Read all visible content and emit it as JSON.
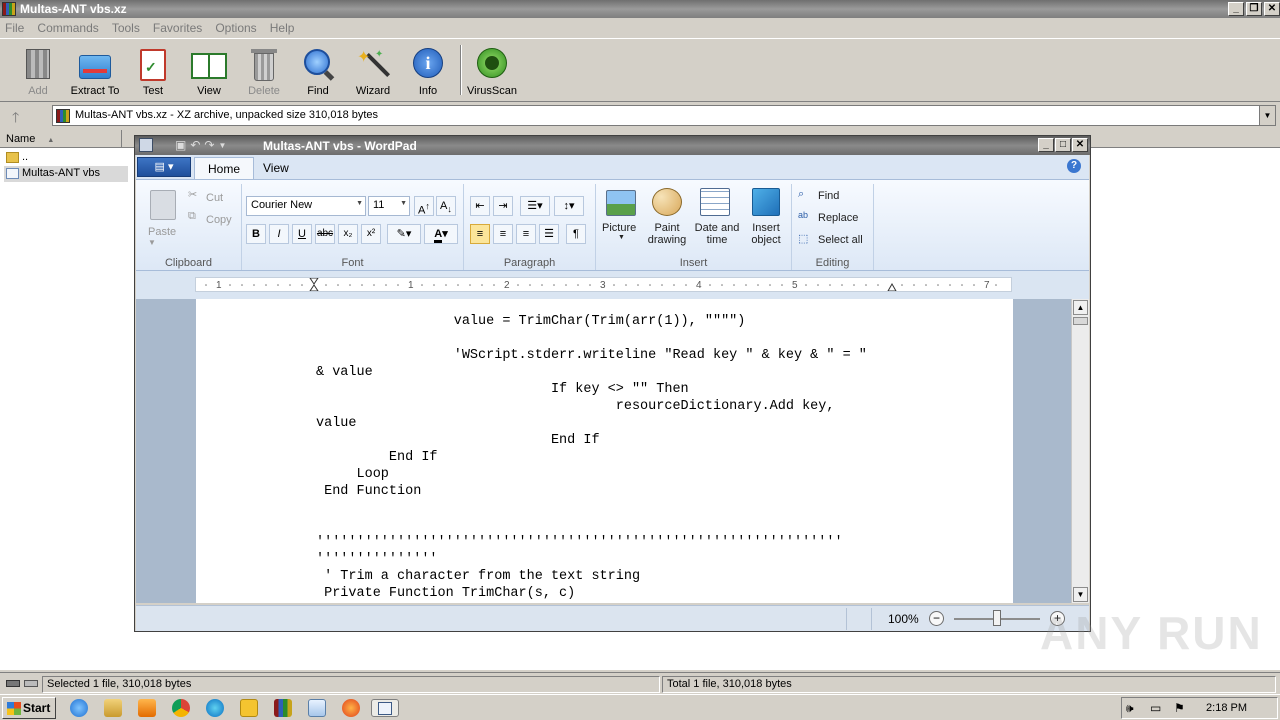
{
  "rar": {
    "title": "Multas-ANT vbs.xz",
    "menu": [
      "File",
      "Commands",
      "Tools",
      "Favorites",
      "Options",
      "Help"
    ],
    "toolbar": [
      {
        "label": "Add",
        "icon": "add-archive-icon",
        "enabled": false
      },
      {
        "label": "Extract To",
        "icon": "extract-folder-icon",
        "enabled": true
      },
      {
        "label": "Test",
        "icon": "test-checklist-icon",
        "enabled": true
      },
      {
        "label": "View",
        "icon": "view-book-icon",
        "enabled": true
      },
      {
        "label": "Delete",
        "icon": "trash-icon",
        "enabled": false
      },
      {
        "label": "Find",
        "icon": "magnifier-icon",
        "enabled": true
      },
      {
        "label": "Wizard",
        "icon": "wizard-wand-icon",
        "enabled": true
      },
      {
        "label": "Info",
        "icon": "info-icon",
        "enabled": true
      },
      {
        "label": "VirusScan",
        "icon": "virus-scan-icon",
        "enabled": true
      }
    ],
    "address": "Multas-ANT vbs.xz - XZ archive, unpacked size 310,018 bytes",
    "column_name": "Name",
    "files": [
      {
        "name": "..",
        "type": "folder"
      },
      {
        "name": "Multas-ANT vbs",
        "type": "file"
      }
    ],
    "status_left": "Selected 1 file, 310,018 bytes",
    "status_right": "Total 1 file, 310,018 bytes"
  },
  "wordpad": {
    "title": "Multas-ANT vbs - WordPad",
    "tabs": [
      "Home",
      "View"
    ],
    "clipboard": {
      "paste": "Paste",
      "cut": "Cut",
      "copy": "Copy",
      "group": "Clipboard"
    },
    "font": {
      "family": "Courier New",
      "size": "11",
      "group": "Font"
    },
    "paragraph_group": "Paragraph",
    "insert": {
      "picture": "Picture",
      "paint_line1": "Paint",
      "paint_line2": "drawing",
      "datetime_line1": "Date and",
      "datetime_line2": "time",
      "object_line1": "Insert",
      "object_line2": "object",
      "group": "Insert"
    },
    "editing": {
      "find": "Find",
      "replace": "Replace",
      "select_all": "Select all",
      "group": "Editing"
    },
    "ruler_marks": [
      "1",
      "1",
      "2",
      "3",
      "4",
      "5",
      "7"
    ],
    "code_lines": [
      "                 value = TrimChar(Trim(arr(1)), \"\"\"\")",
      "",
      "                 'WScript.stderr.writeline \"Read key \" & key & \" = \"",
      "& value",
      "                             If key <> \"\" Then",
      "                                     resourceDictionary.Add key,",
      "value",
      "                             End If",
      "         End If",
      "     Loop",
      " End Function",
      "",
      "",
      "'''''''''''''''''''''''''''''''''''''''''''''''''''''''''''''''''",
      "'''''''''''''''",
      " ' Trim a character from the text string",
      " Private Function TrimChar(s, c)"
    ],
    "zoom": "100%",
    "zoom_level_fraction": 0.5
  },
  "taskbar": {
    "start": "Start",
    "clock": "2:18 PM",
    "apps": [
      "ie-icon",
      "explorer-icon",
      "media-player-icon",
      "chrome-icon",
      "edge-icon",
      "outlook-icon",
      "winrar-icon",
      "notepad-icon",
      "firefox-icon",
      "wordpad-icon"
    ]
  },
  "watermark": "ANY RUN",
  "colors": {
    "winrar_titlebar": "#7e7e7e",
    "ribbon_bg": "#dde8f6",
    "doc_bg": "#a9b9cc"
  }
}
